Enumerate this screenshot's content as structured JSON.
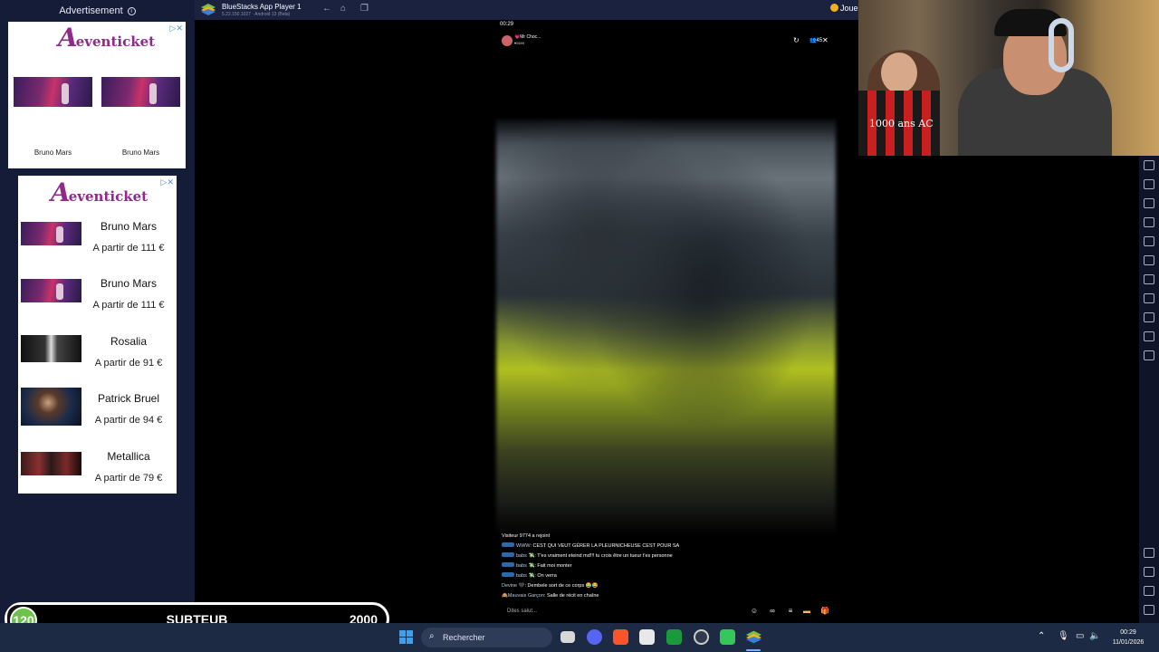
{
  "ads": {
    "header": "Advertisement",
    "close_mark": "▷✕",
    "brand": "eventicket",
    "brand_initial": "A",
    "top_ad": {
      "captions": [
        "Bruno Mars",
        "Bruno Mars"
      ]
    },
    "list_ad": {
      "items": [
        {
          "name": "Bruno Mars",
          "price": "A partir de 111 €"
        },
        {
          "name": "Bruno Mars",
          "price": "A partir de 111 €"
        },
        {
          "name": "Rosalia",
          "price": "A partir de 91 €"
        },
        {
          "name": "Patrick Bruel",
          "price": "A partir de 94 €"
        },
        {
          "name": "Metallica",
          "price": "A partir de 79 €"
        }
      ]
    }
  },
  "goal": {
    "current": "120",
    "label": "SUBTEUB",
    "target": "2000",
    "progress_fraction": 0.06
  },
  "bluestacks": {
    "title": "BlueStacks App Player 1",
    "subtitle": "5.22.150.1027 · Android 13 (Beta)",
    "play_label": "Joue"
  },
  "phone": {
    "time": "00:29",
    "streamer_name": "💗Mr Choc...",
    "likes": "♥5699",
    "viewer_count": "45",
    "chat": [
      {
        "user": "",
        "text": "Visiteur 9774 a rejoint"
      },
      {
        "user": "WWW",
        "text": ": CEST QUI VEUT GÉRER LA PLEURNICHEUSE CEST POUR SA"
      },
      {
        "user": "babs 💸",
        "text": ": T'es vraiment eteind md!!! tu crois être un tueur t'es personne"
      },
      {
        "user": "babs 💸",
        "text": ": Fait moi monter"
      },
      {
        "user": "babs 💸",
        "text": ": On verra"
      },
      {
        "user": "Devine 🖤",
        "text": ": Dembele sort de ce corps 😂😂"
      },
      {
        "user": "🙈Mauvais Garçon",
        "text": ": Salle de récit en chaîne"
      }
    ],
    "input_placeholder": "Dites salut..."
  },
  "webcam": {
    "shirt_text": "1000 ans AC"
  },
  "taskbar": {
    "search_placeholder": "Rechercher",
    "time": "00:29",
    "date": "11/01/2026"
  }
}
